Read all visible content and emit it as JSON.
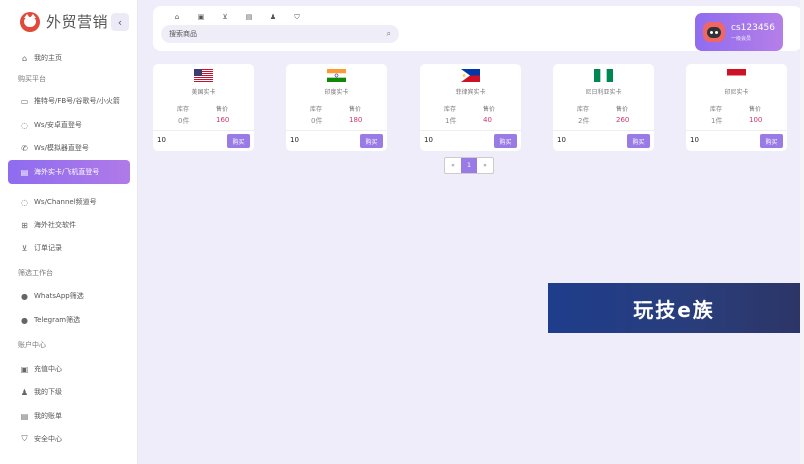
{
  "app": {
    "title": "外贸营销",
    "collapse_glyph": "‹"
  },
  "sidebar": {
    "items": [
      {
        "label": "我的主页",
        "icon": "home-icon",
        "glyph": "⌂"
      },
      {
        "section": "购买平台"
      },
      {
        "label": "推特号/FB号/谷歌号/小火箭",
        "icon": "chat-icon",
        "glyph": "▭"
      },
      {
        "label": "Ws/安卓直登号",
        "icon": "whatsapp-icon",
        "glyph": "◌"
      },
      {
        "label": "Ws/模拟器直登号",
        "icon": "phone-icon",
        "glyph": "✆"
      },
      {
        "label": "海外实卡/飞机直登号",
        "icon": "document-icon",
        "glyph": "▤",
        "active": true
      },
      {
        "label": "Ws/Channel频道号",
        "icon": "whatsapp-icon",
        "glyph": "◌"
      },
      {
        "label": "海外社交软件",
        "icon": "app-box-icon",
        "glyph": "⊞"
      },
      {
        "label": "订单记录",
        "icon": "cart-icon",
        "glyph": "⊻"
      },
      {
        "section": "筛选工作台"
      },
      {
        "label": "WhatsApp筛选",
        "icon": "whatsapp-filled-icon",
        "glyph": "●"
      },
      {
        "label": "Telegram筛选",
        "icon": "telegram-icon",
        "glyph": "●"
      },
      {
        "section": "账户中心"
      },
      {
        "label": "充值中心",
        "icon": "wallet-icon",
        "glyph": "▣"
      },
      {
        "label": "我的下级",
        "icon": "user-icon",
        "glyph": "♟"
      },
      {
        "label": "我的账单",
        "icon": "bill-icon",
        "glyph": "▤"
      },
      {
        "label": "安全中心",
        "icon": "shield-icon",
        "glyph": "⛉"
      }
    ]
  },
  "topbar": {
    "tools": [
      {
        "icon": "home-icon",
        "glyph": "⌂"
      },
      {
        "icon": "image-icon",
        "glyph": "▣"
      },
      {
        "icon": "cart-icon",
        "glyph": "⊻"
      },
      {
        "icon": "list-icon",
        "glyph": "▤"
      },
      {
        "icon": "user-icon",
        "glyph": "♟"
      },
      {
        "icon": "shield-icon",
        "glyph": "⛉"
      }
    ],
    "search": {
      "placeholder": "搜索商品",
      "value": "",
      "icon": "search-icon",
      "glyph": "⌕"
    },
    "user": {
      "name": "cs123456",
      "role": "一级会员"
    }
  },
  "products": {
    "stock_label": "库存",
    "price_label": "售价",
    "buy_label": "购买",
    "items": [
      {
        "name": "美国实卡",
        "flag": "us",
        "stock": "0件",
        "price": "160",
        "qty": "10"
      },
      {
        "name": "印度实卡",
        "flag": "in",
        "stock": "0件",
        "price": "180",
        "qty": "10"
      },
      {
        "name": "菲律宾实卡",
        "flag": "ph",
        "stock": "1件",
        "price": "40",
        "qty": "10"
      },
      {
        "name": "尼日利亚实卡",
        "flag": "ng",
        "stock": "2件",
        "price": "260",
        "qty": "10"
      },
      {
        "name": "印尼实卡",
        "flag": "id",
        "stock": "1件",
        "price": "100",
        "qty": "10"
      }
    ]
  },
  "pagination": {
    "prev": "«",
    "current": "1",
    "next": "»"
  },
  "banner": {
    "text": "玩技e族"
  }
}
